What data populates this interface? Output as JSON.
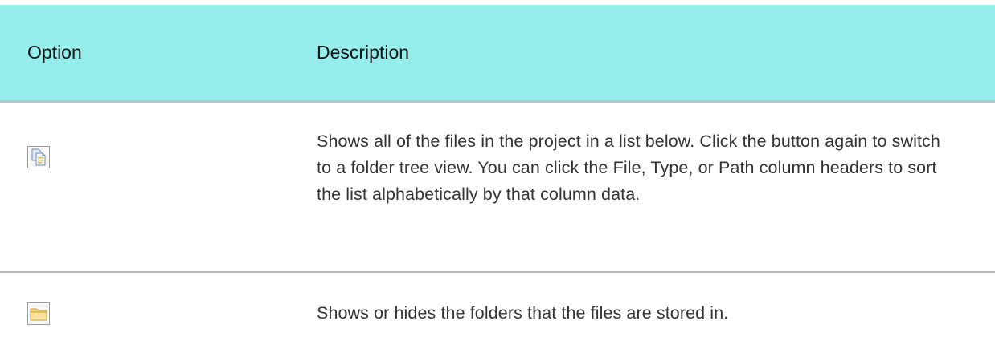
{
  "table": {
    "headers": {
      "option": "Option",
      "description": "Description"
    },
    "rows": [
      {
        "icon": "show-files-icon",
        "description": "Shows all of the files in the project in a list below. Click the button again to switch to a folder tree view. You can click the File, Type, or Path column headers to sort the list alphabetically by that column data."
      },
      {
        "icon": "folder-icon",
        "description": "Shows or hides the folders that the files are stored in."
      }
    ]
  },
  "colors": {
    "header_background": "#95eeec",
    "row_divider": "#b7b7b7",
    "text": "#333333"
  }
}
